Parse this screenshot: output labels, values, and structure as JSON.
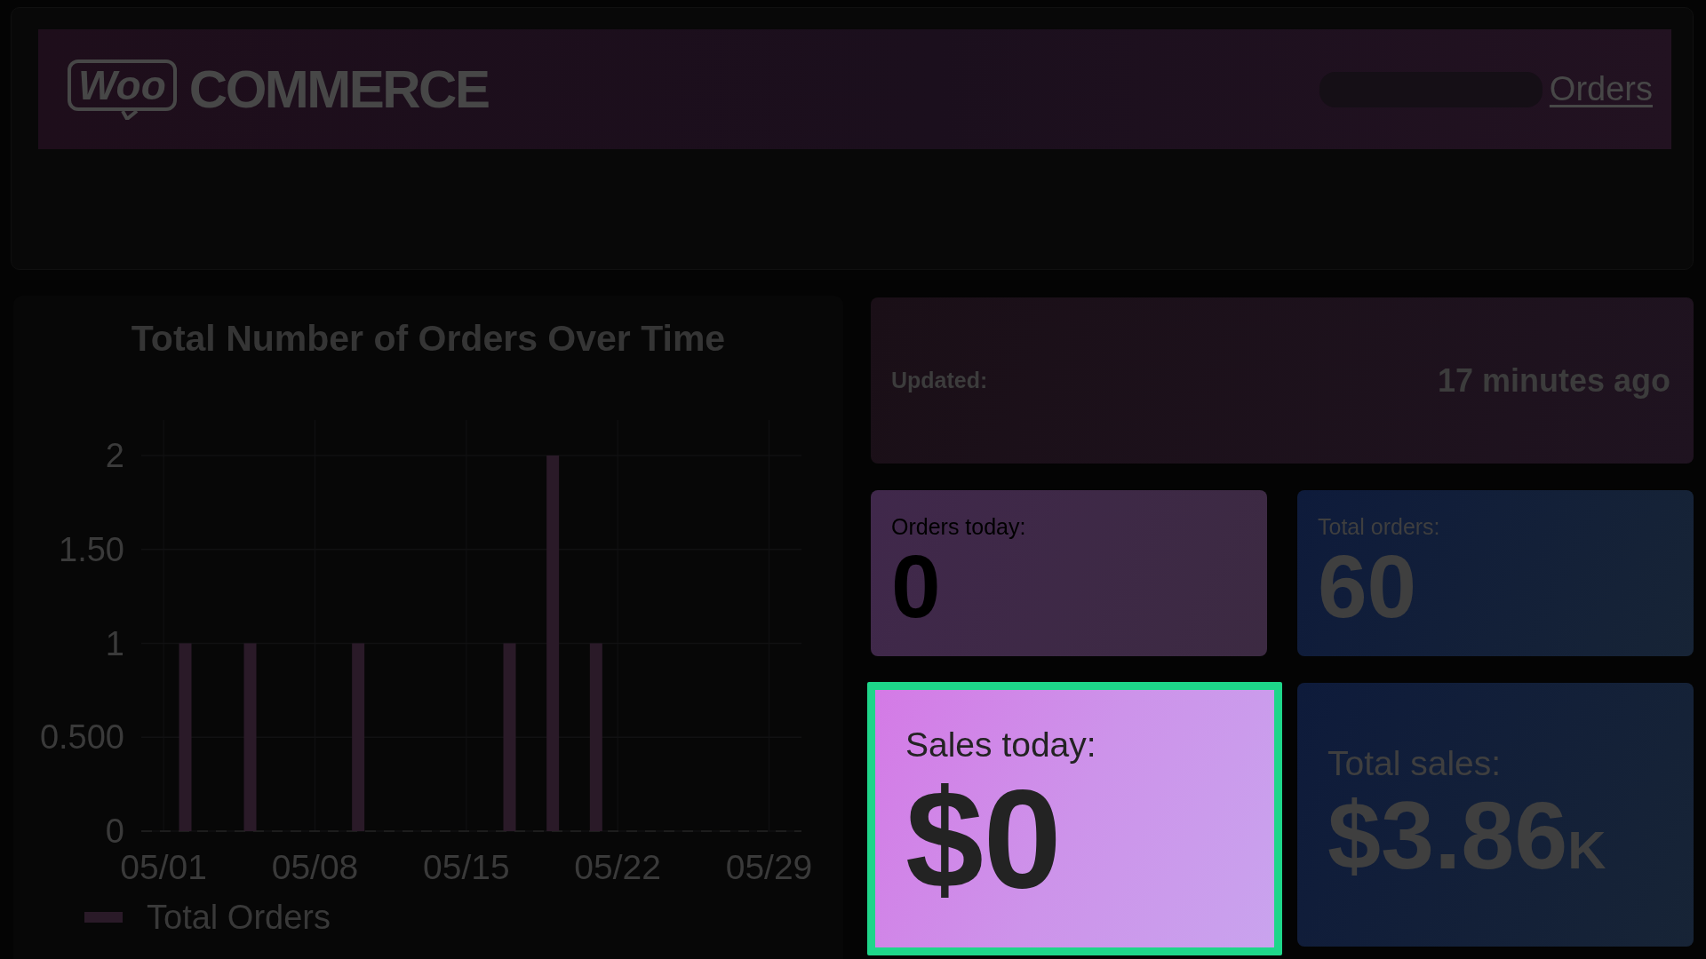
{
  "header": {
    "logo": {
      "badge": "Woo",
      "wordmark": "COMMERCE"
    },
    "links": [
      {
        "label": "Orders"
      }
    ]
  },
  "chart_panel": {
    "chart_data": {
      "type": "bar",
      "title": "Total Number of Orders Over Time",
      "categories": [
        "05/01",
        null,
        null,
        null,
        null,
        null,
        null,
        "05/08",
        null,
        null,
        null,
        null,
        null,
        null,
        "05/15",
        null,
        null,
        null,
        null,
        null,
        null,
        "05/22",
        null,
        null,
        null,
        null,
        null,
        null,
        "05/29",
        null
      ],
      "series": [
        {
          "name": "Total Orders",
          "color": "#2a1a28",
          "values": [
            0,
            1,
            0,
            0,
            1,
            0,
            0,
            0,
            0,
            1,
            0,
            0,
            0,
            0,
            0,
            0,
            1,
            0,
            2,
            0,
            1,
            0,
            0,
            0,
            0,
            0,
            0,
            0,
            0,
            0
          ]
        }
      ],
      "ylim": [
        0,
        2
      ],
      "yticks": [
        {
          "value": 0,
          "label": "0"
        },
        {
          "value": 0.5,
          "label": "0.500"
        },
        {
          "value": 1,
          "label": "1"
        },
        {
          "value": 1.5,
          "label": "1.50"
        },
        {
          "value": 2,
          "label": "2"
        }
      ],
      "grid": true
    }
  },
  "cards": [
    {
      "kind": "wide",
      "label": "Updated:",
      "value": "17 minutes ago",
      "highlighted": false
    },
    {
      "kind": "stat",
      "label": "Orders today:",
      "value": "0",
      "highlighted": false
    },
    {
      "kind": "stat",
      "label": "Total orders:",
      "value": "60",
      "highlighted": false
    },
    {
      "kind": "stat",
      "label": "Sales today:",
      "value": "$0",
      "highlighted": true
    },
    {
      "kind": "stat",
      "label": "Total sales:",
      "value": "$3.86",
      "unit": "K",
      "highlighted": false
    }
  ]
}
